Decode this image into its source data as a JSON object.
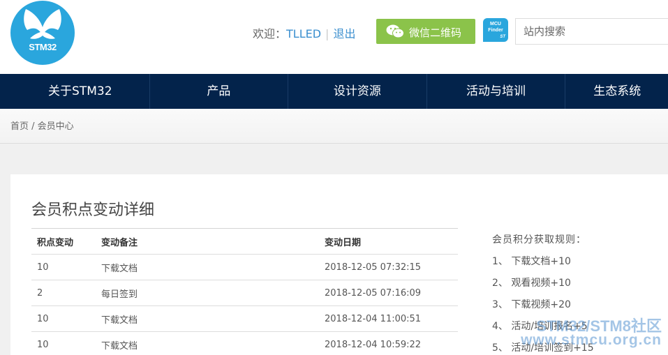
{
  "logo": {
    "text": "STM32"
  },
  "header": {
    "welcome_prefix": "欢迎：",
    "username": "TLLED",
    "separator": "|",
    "logout": "退出",
    "wechat_button": "微信二维码",
    "mcu_finder_line1": "MCU",
    "mcu_finder_line2": "Finder",
    "mcu_finder_brand": "ST",
    "search_placeholder": "站内搜索"
  },
  "nav": {
    "items": [
      "关于STM32",
      "产品",
      "设计资源",
      "活动与培训",
      "生态系统"
    ]
  },
  "breadcrumb": {
    "text": "首页 / 会员中心"
  },
  "main": {
    "title": "会员积点变动详细",
    "table": {
      "headers": [
        "积点变动",
        "变动备注",
        "变动日期"
      ],
      "rows": [
        [
          "10",
          "下载文档",
          "2018-12-05 07:32:15"
        ],
        [
          "2",
          "每日签到",
          "2018-12-05 07:16:09"
        ],
        [
          "10",
          "下载文档",
          "2018-12-04 11:00:51"
        ],
        [
          "10",
          "下载文档",
          "2018-12-04 10:59:22"
        ]
      ]
    },
    "rules": {
      "title": "会员积分获取规则：",
      "items": [
        "1、 下载文档+10",
        "2、 观看视频+10",
        "3、 下载视频+20",
        "4、 活动/培训报名+5",
        "5、 活动/培训签到+15"
      ]
    }
  },
  "watermark": {
    "line1": "STM32/STM8社区",
    "line2": "www.stmcu.org.cn"
  },
  "colors": {
    "nav_bg": "#03234b",
    "logo_blue": "#2aa6dd",
    "wechat_green": "#8bc34a",
    "link_blue": "#3b8fcf"
  }
}
